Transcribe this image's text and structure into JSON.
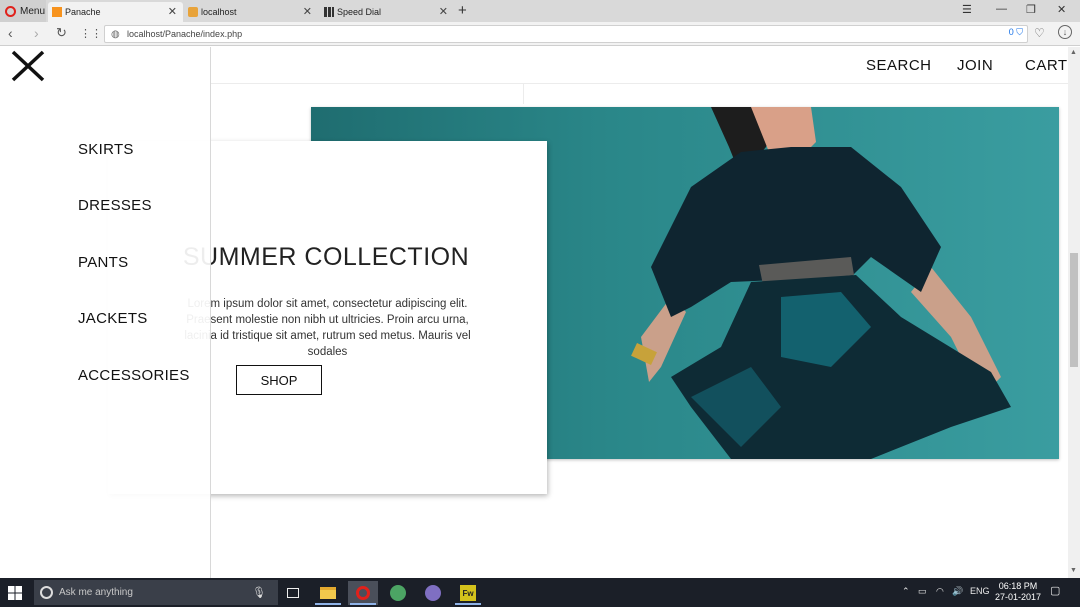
{
  "browser": {
    "menu_label": "Menu",
    "tabs": [
      {
        "title": "Panache",
        "active": true
      },
      {
        "title": "localhost",
        "active": false
      },
      {
        "title": "Speed Dial",
        "active": false
      }
    ],
    "url": "localhost/Panache/index.php",
    "adblock_count": "0"
  },
  "side_menu": {
    "items": [
      "SKIRTS",
      "DRESSES",
      "PANTS",
      "JACKETS",
      "ACCESSORIES"
    ]
  },
  "header_nav": {
    "search": "SEARCH",
    "join": "JOIN",
    "cart": "CART"
  },
  "hero": {
    "title": "SUMMER COLLECTION",
    "body": "Lorem ipsum dolor sit amet, consectetur adipiscing elit. Praesent molestie non nibh ut ultricies. Proin arcu urna, lacinia id tristique sit amet, rutrum sed metus. Mauris vel sodales",
    "button": "SHOP"
  },
  "taskbar": {
    "search_placeholder": "Ask me anything",
    "language": "ENG",
    "time": "06:18 PM",
    "date": "27-01-2017"
  }
}
